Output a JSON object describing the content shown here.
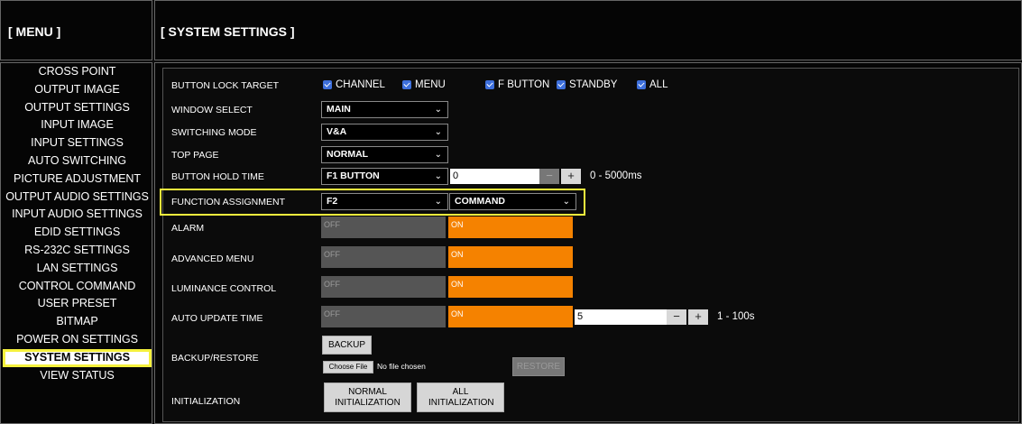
{
  "sidebar_header": "[ MENU ]",
  "main_header": "[ SYSTEM SETTINGS ]",
  "menu": [
    "CROSS POINT",
    "OUTPUT IMAGE",
    "OUTPUT SETTINGS",
    "INPUT IMAGE",
    "INPUT SETTINGS",
    "AUTO SWITCHING",
    "PICTURE ADJUSTMENT",
    "OUTPUT AUDIO SETTINGS",
    "INPUT AUDIO SETTINGS",
    "EDID SETTINGS",
    "RS-232C SETTINGS",
    "LAN SETTINGS",
    "CONTROL COMMAND",
    "USER PRESET",
    "BITMAP",
    "POWER ON SETTINGS",
    "SYSTEM SETTINGS",
    "VIEW STATUS"
  ],
  "selected_menu": "SYSTEM SETTINGS",
  "settings": {
    "button_lock": {
      "label": "BUTTON LOCK TARGET",
      "options": [
        "CHANNEL",
        "MENU",
        "F BUTTON",
        "STANDBY",
        "ALL"
      ]
    },
    "window_select": {
      "label": "WINDOW SELECT",
      "value": "MAIN"
    },
    "switching_mode": {
      "label": "SWITCHING MODE",
      "value": "V&A"
    },
    "top_page": {
      "label": "TOP PAGE",
      "value": "NORMAL"
    },
    "button_hold": {
      "label": "BUTTON HOLD TIME",
      "select": "F1 BUTTON",
      "value": "0",
      "range": "0 - 5000ms"
    },
    "function_assign": {
      "label": "FUNCTION ASSIGNMENT",
      "select1": "F2",
      "select2": "COMMAND"
    },
    "alarm": {
      "label": "ALARM"
    },
    "advanced_menu": {
      "label": "ADVANCED MENU"
    },
    "luminance": {
      "label": "LUMINANCE CONTROL"
    },
    "auto_update": {
      "label": "AUTO UPDATE TIME",
      "value": "5",
      "range": "1 - 100s"
    },
    "backup_restore": {
      "label": "BACKUP/RESTORE",
      "backup": "BACKUP",
      "choose_file": "Choose File",
      "no_file": "No file chosen",
      "restore": "RESTORE"
    },
    "initialization": {
      "label": "INITIALIZATION",
      "normal": "NORMAL INITIALIZATION",
      "all": "ALL INITIALIZATION"
    }
  },
  "toggle": {
    "off": "OFF",
    "on": "ON"
  },
  "stepper": {
    "minus": "−",
    "plus": "+"
  },
  "colors": {
    "on": "#f58200",
    "off": "#555555",
    "highlight": "#f5f13d",
    "checkbox": "#3d6fdc"
  }
}
